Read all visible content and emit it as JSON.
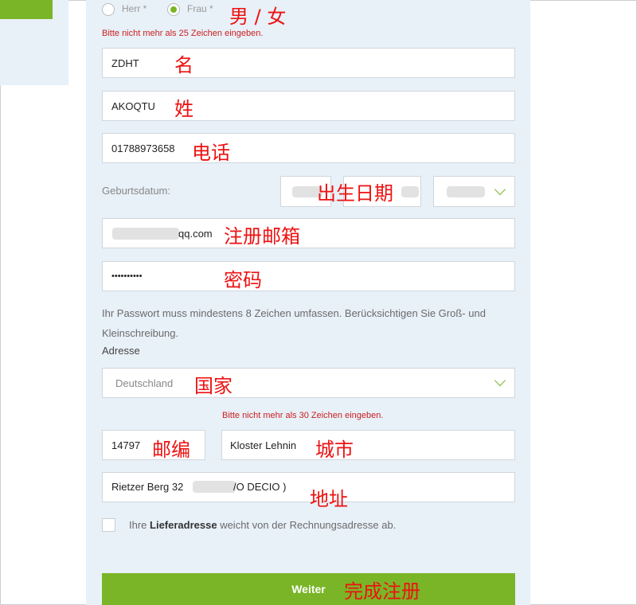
{
  "gender": {
    "herr_label": "Herr *",
    "frau_label": "Frau *",
    "selected": "Frau",
    "annotation": "男 / 女"
  },
  "errors": {
    "max25": "Bitte nicht mehr als 25 Zeichen eingeben.",
    "max30": "Bitte nicht mehr als 30 Zeichen eingeben."
  },
  "first_name": {
    "value": "ZDHT",
    "annotation": "名"
  },
  "last_name": {
    "value": "AKOQTU",
    "annotation": "姓"
  },
  "phone": {
    "value": "01788973658",
    "annotation": "电话"
  },
  "birthdate": {
    "label": "Geburtsdatum:",
    "annotation": "出生日期"
  },
  "email": {
    "value": "qq.com",
    "annotation": "注册邮箱"
  },
  "password": {
    "value": "••••••••••",
    "annotation": "密码"
  },
  "password_help": "Ihr Passwort muss mindestens 8 Zeichen umfassen. Berücksichtigen Sie Groß- und Kleinschreibung.",
  "address": {
    "label": "Adresse",
    "country": {
      "value": "Deutschland",
      "annotation": "国家"
    },
    "zip": {
      "value": "14797",
      "annotation": "邮编"
    },
    "city": {
      "value": "Kloster Lehnin",
      "annotation": "城市"
    },
    "street": {
      "value_prefix": "Rietzer Berg 32",
      "value_suffix": "/O DECIO )",
      "annotation": "地址"
    }
  },
  "delivery": {
    "prefix": "Ihre ",
    "bold": "Lieferadresse",
    "suffix": " weicht von der Rechnungsadresse ab."
  },
  "submit": {
    "label": "Weiter",
    "annotation": "完成注册"
  },
  "colors": {
    "accent": "#7ab527",
    "panel": "#e8f0f8",
    "error": "#cc1f1f",
    "annotation": "#ee1111"
  }
}
